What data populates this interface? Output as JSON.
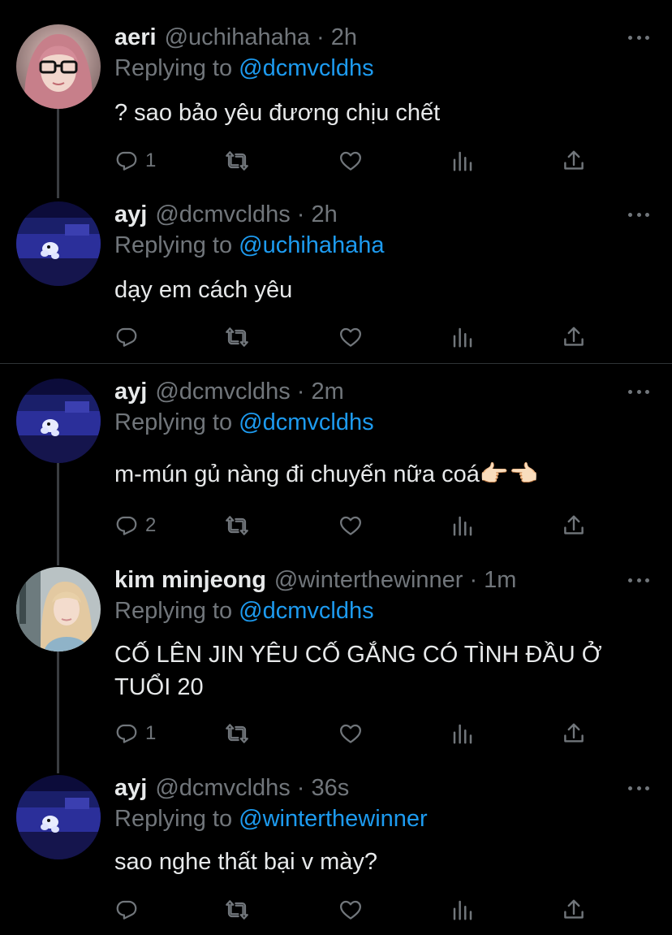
{
  "tweets": [
    {
      "name": "aeri",
      "handle": "@uchihahaha",
      "time": "2h",
      "replying_label": "Replying to",
      "replying_to": "@dcmvcldhs",
      "text_lines": [
        "? sao bảo yêu đương chịu chết"
      ],
      "reply_count": "1",
      "avatar": "pink-hair-glasses"
    },
    {
      "name": "ayj",
      "handle": "@dcmvcldhs",
      "time": "2h",
      "replying_label": "Replying to",
      "replying_to": "@uchihahaha",
      "text_lines": [
        "dạy em cách yêu"
      ],
      "reply_count": "",
      "avatar": "blue-night-cartoon"
    },
    {
      "name": "ayj",
      "handle": "@dcmvcldhs",
      "time": "2m",
      "replying_label": "Replying to",
      "replying_to": "@dcmvcldhs",
      "text_lines": [
        "m-mún gủ nàng đi chuyến nữa coá👉🏻👈🏻"
      ],
      "reply_count": "2",
      "avatar": "blue-night-cartoon"
    },
    {
      "name": "kim minjeong",
      "handle": "@winterthewinner",
      "time": "1m",
      "replying_label": "Replying to",
      "replying_to": "@dcmvcldhs",
      "text_lines": [
        "CỐ LÊN JIN YÊU CỐ GẮNG CÓ TÌNH ĐẦU Ở",
        "TUỔI 20"
      ],
      "reply_count": "1",
      "avatar": "blonde-girl-photo"
    },
    {
      "name": "ayj",
      "handle": "@dcmvcldhs",
      "time": "36s",
      "replying_label": "Replying to",
      "replying_to": "@winterthewinner",
      "text_lines": [
        "sao nghe thất bại v mày?"
      ],
      "reply_count": "",
      "avatar": "blue-night-cartoon"
    }
  ],
  "separator": "·",
  "icons": {
    "reply": "reply-icon",
    "retweet": "retweet-icon",
    "like": "heart-icon",
    "analytics": "analytics-icon",
    "share": "share-icon",
    "more": "more-icon"
  },
  "colors": {
    "background": "#000000",
    "text": "#e7e9ea",
    "muted": "#71767b",
    "link": "#1d9bf0",
    "divider": "#2f3336",
    "thread_line": "#3a3d41"
  }
}
